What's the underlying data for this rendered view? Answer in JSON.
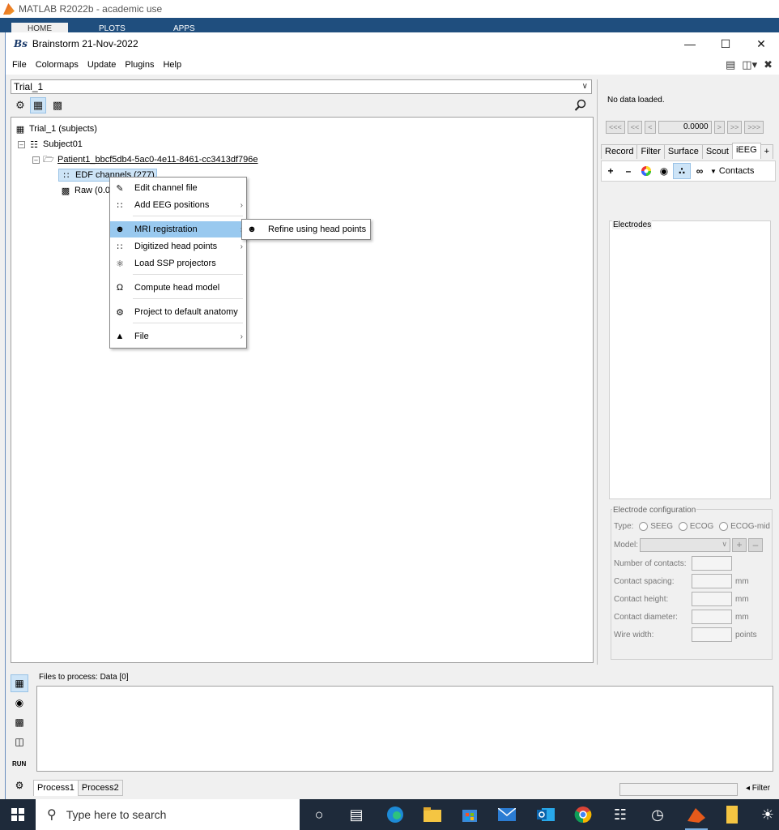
{
  "matlab": {
    "title": "MATLAB R2022b - academic use",
    "tabs": [
      "HOME",
      "PLOTS",
      "APPS"
    ]
  },
  "window": {
    "logo": "Bs",
    "title": "Brainstorm 21-Nov-2022"
  },
  "menubar": {
    "items": [
      "File",
      "Colormaps",
      "Update",
      "Plugins",
      "Help"
    ]
  },
  "protocol": {
    "selected": "Trial_1"
  },
  "tree": {
    "root": "Trial_1 (subjects)",
    "subject": "Subject01",
    "condition": "Patient1_bbcf5db4-5ac0-4e11-8461-cc3413df796e",
    "channel": "EDF channels (277)",
    "raw": "Raw (0.0"
  },
  "context_menu": {
    "items": [
      {
        "label": "Edit channel file",
        "icon": "edit-icon",
        "submenu": false
      },
      {
        "label": "Add EEG positions",
        "icon": "eeg-dots-icon",
        "submenu": true
      },
      {
        "label": "MRI registration",
        "icon": "head-icon",
        "submenu": true
      },
      {
        "label": "Digitized head points",
        "icon": "eeg-dots-icon",
        "submenu": true
      },
      {
        "label": "Load SSP projectors",
        "icon": "projector-icon",
        "submenu": false
      },
      {
        "label": "Compute head model",
        "icon": "headmodel-icon",
        "submenu": false
      },
      {
        "label": "Project to default anatomy",
        "icon": "project-icon",
        "submenu": false
      },
      {
        "label": "File",
        "icon": "file-icon",
        "submenu": true
      }
    ],
    "submenu_item": "Refine using head points"
  },
  "right_panel": {
    "status": "No data loaded.",
    "nav_buttons": [
      "<<<",
      "<<",
      "<",
      ">",
      ">>",
      ">>>"
    ],
    "time_value": "0.0000",
    "tabs": [
      "Record",
      "Filter",
      "Surface",
      "Scout",
      "iEEG",
      "+"
    ],
    "active_tab": "iEEG",
    "contacts_label": "Contacts",
    "electrodes_label": "Electrodes",
    "config": {
      "title": "Electrode configuration",
      "type_label": "Type:",
      "types": [
        "SEEG",
        "ECOG",
        "ECOG-mid"
      ],
      "model_label": "Model:",
      "fields": [
        {
          "label": "Number of contacts:",
          "unit": ""
        },
        {
          "label": "Contact spacing:",
          "unit": "mm"
        },
        {
          "label": "Contact height:",
          "unit": "mm"
        },
        {
          "label": "Contact diameter:",
          "unit": "mm"
        },
        {
          "label": "Wire width:",
          "unit": "points"
        }
      ]
    }
  },
  "process": {
    "files_label": "Files to process: Data [0]",
    "run_label": "RUN",
    "tabs": [
      "Process1",
      "Process2"
    ],
    "filter_label": "◂ Filter"
  },
  "taskbar": {
    "search_placeholder": "Type here to search"
  }
}
